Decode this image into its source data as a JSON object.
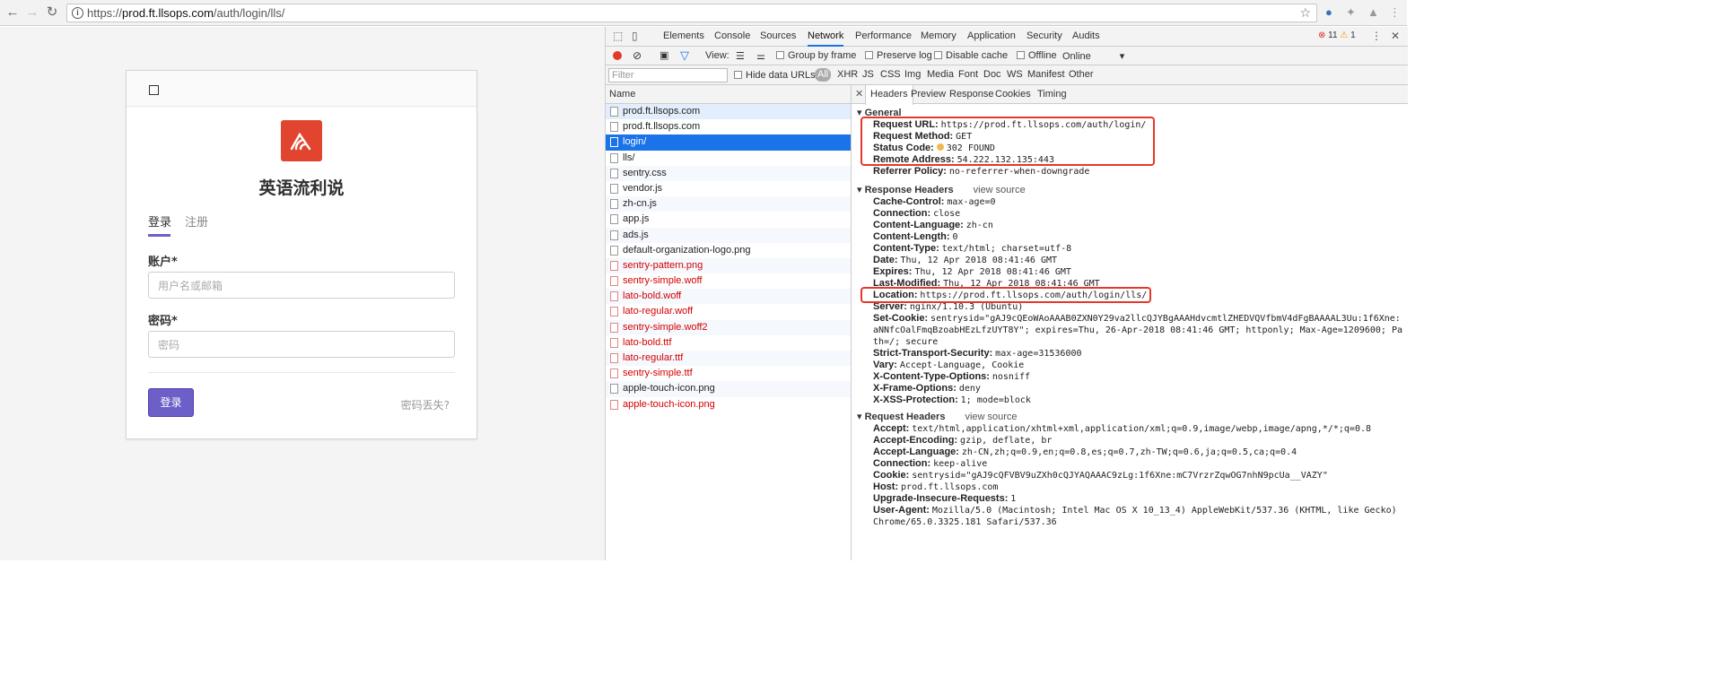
{
  "browser": {
    "url_prefix": "https://",
    "url_host": "prod.ft.llsops.com",
    "url_path": "/auth/login/lls/",
    "icons": [
      "back-icon",
      "forward-icon",
      "reload-icon",
      "info-icon",
      "star-icon"
    ]
  },
  "login": {
    "site_name": "英语流利说",
    "tab_login": "登录",
    "tab_register": "注册",
    "account_label": "账户*",
    "account_placeholder": "用户名或邮箱",
    "password_label": "密码*",
    "password_placeholder": "密码",
    "submit": "登录",
    "forgot": "密码丢失?",
    "brand_color": "#e2452f",
    "accent_color": "#6c5fc7"
  },
  "devtools": {
    "tabs": [
      "Elements",
      "Console",
      "Sources",
      "Network",
      "Performance",
      "Memory",
      "Application",
      "Security",
      "Audits"
    ],
    "active_tab": "Network",
    "errors": "11",
    "warnings": "1",
    "toolbar": {
      "view_label": "View:",
      "group_by_frame": "Group by frame",
      "preserve_log": "Preserve log",
      "disable_cache": "Disable cache",
      "offline": "Offline",
      "throttle": "Online"
    },
    "filter": {
      "placeholder": "Filter",
      "hide_data_urls": "Hide data URLs",
      "types": [
        "All",
        "XHR",
        "JS",
        "CSS",
        "Img",
        "Media",
        "Font",
        "Doc",
        "WS",
        "Manifest",
        "Other"
      ]
    },
    "requests_header": "Name",
    "requests": [
      {
        "name": "prod.ft.llsops.com",
        "state": "hl"
      },
      {
        "name": "prod.ft.llsops.com",
        "state": ""
      },
      {
        "name": "login/",
        "state": "sel"
      },
      {
        "name": "lls/",
        "state": ""
      },
      {
        "name": "sentry.css",
        "state": ""
      },
      {
        "name": "vendor.js",
        "state": ""
      },
      {
        "name": "zh-cn.js",
        "state": ""
      },
      {
        "name": "app.js",
        "state": ""
      },
      {
        "name": "ads.js",
        "state": ""
      },
      {
        "name": "default-organization-logo.png",
        "state": ""
      },
      {
        "name": "sentry-pattern.png",
        "state": "red"
      },
      {
        "name": "sentry-simple.woff",
        "state": "red"
      },
      {
        "name": "lato-bold.woff",
        "state": "red"
      },
      {
        "name": "lato-regular.woff",
        "state": "red"
      },
      {
        "name": "sentry-simple.woff2",
        "state": "red"
      },
      {
        "name": "lato-bold.ttf",
        "state": "red"
      },
      {
        "name": "lato-regular.ttf",
        "state": "red"
      },
      {
        "name": "sentry-simple.ttf",
        "state": "red"
      },
      {
        "name": "apple-touch-icon.png",
        "state": ""
      },
      {
        "name": "apple-touch-icon.png",
        "state": "red"
      }
    ],
    "detail_tabs": [
      "Headers",
      "Preview",
      "Response",
      "Cookies",
      "Timing"
    ],
    "general_title": "General",
    "general": [
      {
        "k": "Request URL:",
        "v": "https://prod.ft.llsops.com/auth/login/"
      },
      {
        "k": "Request Method:",
        "v": "GET"
      },
      {
        "k": "Status Code:",
        "v": "302 FOUND"
      },
      {
        "k": "Remote Address:",
        "v": "54.222.132.135:443"
      },
      {
        "k": "Referrer Policy:",
        "v": "no-referrer-when-downgrade"
      }
    ],
    "response_title": "Response Headers",
    "view_source": "view source",
    "response": [
      {
        "k": "Cache-Control:",
        "v": "max-age=0"
      },
      {
        "k": "Connection:",
        "v": "close"
      },
      {
        "k": "Content-Language:",
        "v": "zh-cn"
      },
      {
        "k": "Content-Length:",
        "v": "0"
      },
      {
        "k": "Content-Type:",
        "v": "text/html; charset=utf-8"
      },
      {
        "k": "Date:",
        "v": "Thu, 12 Apr 2018 08:41:46 GMT"
      },
      {
        "k": "Expires:",
        "v": "Thu, 12 Apr 2018 08:41:46 GMT"
      },
      {
        "k": "Last-Modified:",
        "v": "Thu, 12 Apr 2018 08:41:46 GMT"
      },
      {
        "k": "Location:",
        "v": "https://prod.ft.llsops.com/auth/login/lls/"
      },
      {
        "k": "Server:",
        "v": "nginx/1.10.3 (Ubuntu)"
      },
      {
        "k": "Set-Cookie:",
        "v": "sentrysid=\"gAJ9cQEoWAoAAAB0ZXN0Y29va2llcQJYBgAAAHdvcmtlZHEDVQVfbmV4dFgBAAAAL3Uu:1f6Xne:aNNfcOalFmqBzoabHEzLfzUYT8Y\"; expires=Thu, 26-Apr-2018 08:41:46 GMT; httponly; Max-Age=1209600; Path=/; secure"
      },
      {
        "k": "Strict-Transport-Security:",
        "v": "max-age=31536000"
      },
      {
        "k": "Vary:",
        "v": "Accept-Language, Cookie"
      },
      {
        "k": "X-Content-Type-Options:",
        "v": "nosniff"
      },
      {
        "k": "X-Frame-Options:",
        "v": "deny"
      },
      {
        "k": "X-XSS-Protection:",
        "v": "1; mode=block"
      }
    ],
    "request_title": "Request Headers",
    "request": [
      {
        "k": "Accept:",
        "v": "text/html,application/xhtml+xml,application/xml;q=0.9,image/webp,image/apng,*/*;q=0.8"
      },
      {
        "k": "Accept-Encoding:",
        "v": "gzip, deflate, br"
      },
      {
        "k": "Accept-Language:",
        "v": "zh-CN,zh;q=0.9,en;q=0.8,es;q=0.7,zh-TW;q=0.6,ja;q=0.5,ca;q=0.4"
      },
      {
        "k": "Connection:",
        "v": "keep-alive"
      },
      {
        "k": "Cookie:",
        "v": "sentrysid=\"gAJ9cQFVBV9uZXh0cQJYAQAAAC9zLg:1f6Xne:mC7VrzrZqwOG7nhN9pcUa__VAZY\""
      },
      {
        "k": "Host:",
        "v": "prod.ft.llsops.com"
      },
      {
        "k": "Upgrade-Insecure-Requests:",
        "v": "1"
      },
      {
        "k": "User-Agent:",
        "v": "Mozilla/5.0 (Macintosh; Intel Mac OS X 10_13_4) AppleWebKit/537.36 (KHTML, like Gecko) Chrome/65.0.3325.181 Safari/537.36"
      }
    ],
    "highlight_color": "#e6382a"
  }
}
